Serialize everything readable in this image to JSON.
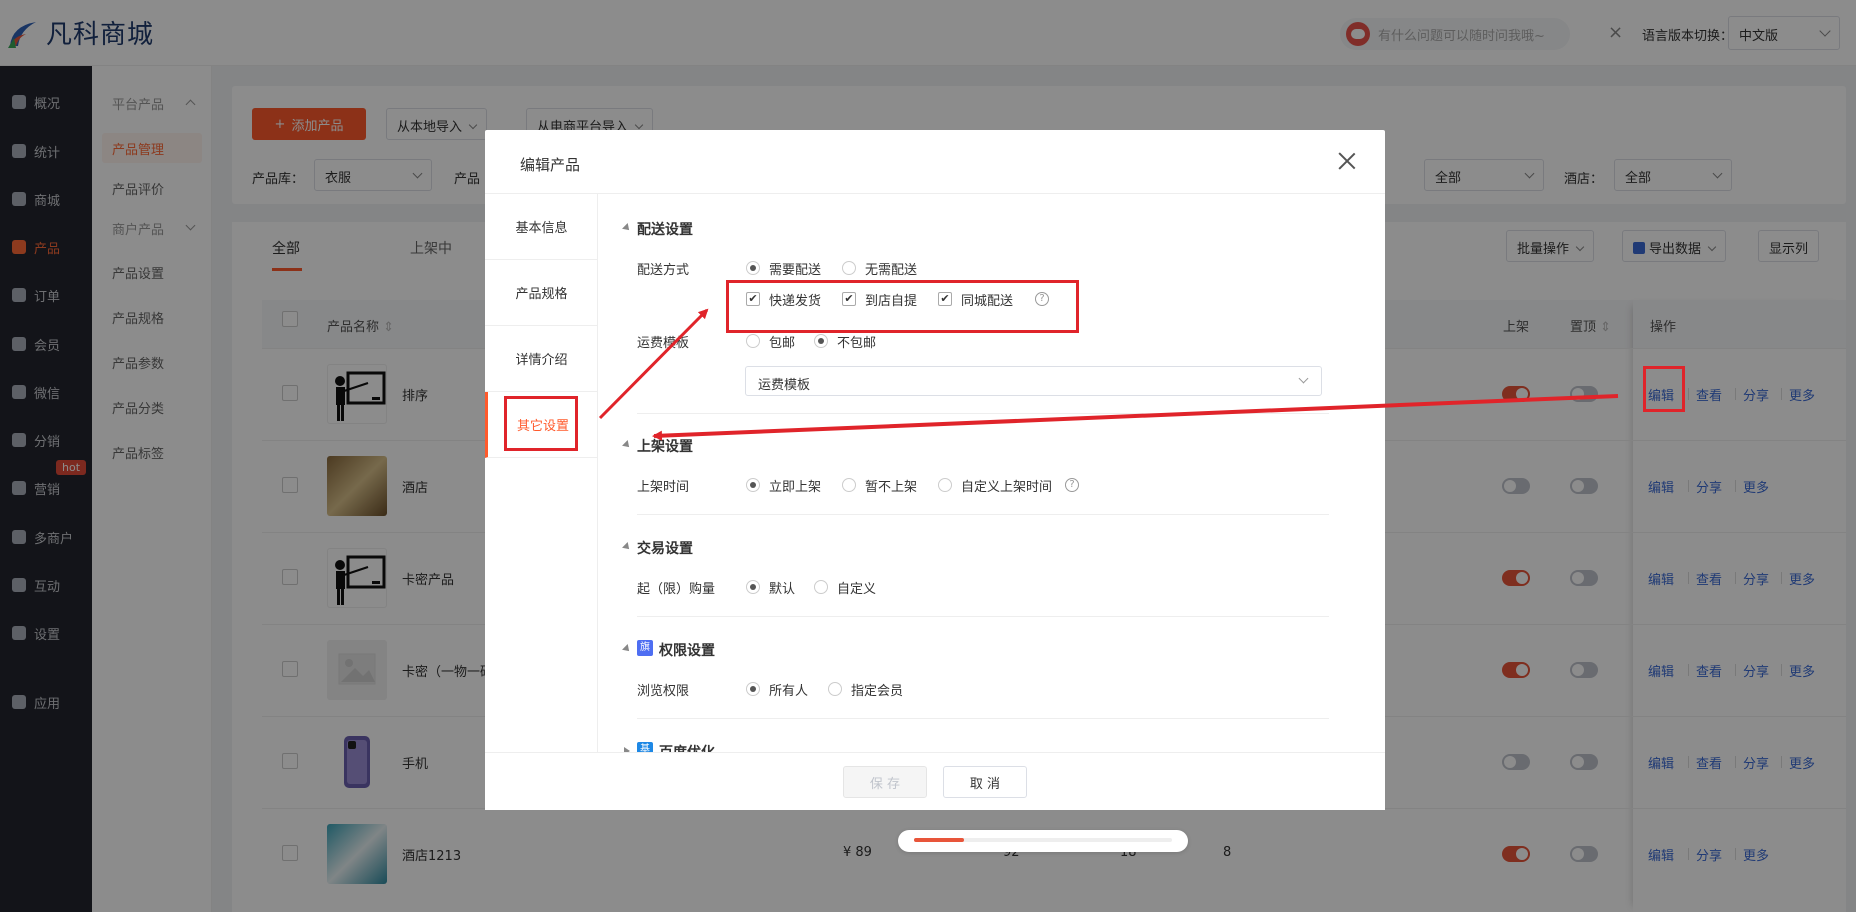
{
  "header": {
    "logo_text": "凡科商城",
    "ask_placeholder": "有什么问题可以随时问我哦~",
    "close_glyph": "×",
    "lang_label": "语言版本切换：",
    "lang_value": "中文版"
  },
  "nav": {
    "items": [
      "概况",
      "统计",
      "商城",
      "产品",
      "订单",
      "会员",
      "微信",
      "分销",
      "营销",
      "多商户",
      "互动",
      "设置",
      "应用"
    ],
    "hot_badge": "hot"
  },
  "subnav": {
    "group1": "平台产品",
    "items1": [
      "产品管理",
      "产品评价"
    ],
    "group2": "商户产品",
    "items2": [
      "产品设置",
      "产品规格",
      "产品参数",
      "产品分类",
      "产品标签"
    ]
  },
  "toolbar": {
    "add_btn": "添加产品",
    "add_plus": "+",
    "import_local": "从本地导入",
    "import_platform": "从电商平台导入"
  },
  "filters": {
    "lib_label": "产品库：",
    "lib_value": "衣服",
    "cut_label": "产品",
    "all_value": "全部",
    "hotel_label": "酒店：",
    "hotel_value": "全部"
  },
  "tabs": [
    "全部",
    "上架中"
  ],
  "table_actions": {
    "bulk": "批量操作",
    "export": "导出数据",
    "columns": "显示列"
  },
  "table": {
    "headers": {
      "name": "产品名称",
      "on": "上架",
      "top": "置顶",
      "ops": "操作"
    },
    "rows": [
      {
        "name": "排序",
        "on": true,
        "top": false,
        "ops": [
          "编辑",
          "查看",
          "分享",
          "更多"
        ]
      },
      {
        "name": "酒店",
        "on": false,
        "top": false,
        "ops": [
          "编辑",
          "分享",
          "更多"
        ]
      },
      {
        "name": "卡密产品",
        "on": true,
        "top": false,
        "ops": [
          "编辑",
          "查看",
          "分享",
          "更多"
        ]
      },
      {
        "name": "卡密（一物一码",
        "on": true,
        "top": false,
        "ops": [
          "编辑",
          "查看",
          "分享",
          "更多"
        ]
      },
      {
        "name": "手机",
        "on": false,
        "top": false,
        "ops": [
          "编辑",
          "查看",
          "分享",
          "更多"
        ]
      },
      {
        "name": "酒店1213",
        "price": "¥ 89",
        "c1": "92",
        "c2": "18",
        "c3": "8",
        "on": true,
        "top": false,
        "ops": [
          "编辑",
          "分享",
          "更多"
        ]
      }
    ]
  },
  "modal": {
    "title": "编辑产品",
    "side_tabs": [
      "基本信息",
      "产品规格",
      "详情介绍",
      "其它设置"
    ],
    "delivery": {
      "section": "配送设置",
      "method_label": "配送方式",
      "need": "需要配送",
      "no_need": "无需配送",
      "express": "快递发货",
      "pickup": "到店自提",
      "city": "同城配送",
      "check_glyph": "✔",
      "help_glyph": "?",
      "freight_label": "运费模板",
      "free": "包邮",
      "not_free": "不包邮",
      "template_value": "运费模板"
    },
    "listing": {
      "section": "上架设置",
      "time_label": "上架时间",
      "now": "立即上架",
      "later": "暂不上架",
      "custom": "自定义上架时间"
    },
    "trade": {
      "section": "交易设置",
      "qty_label": "起（限）购量",
      "default": "默认",
      "custom": "自定义"
    },
    "permission": {
      "badge": "旗",
      "section": "权限设置",
      "view_label": "浏览权限",
      "all": "所有人",
      "member": "指定会员"
    },
    "seo": {
      "badge": "基",
      "section": "百度优化"
    },
    "save": "保 存",
    "cancel": "取 消"
  },
  "colors": {
    "accent": "#ff5a2c",
    "annotation": "#e0242a",
    "link": "#3b6bd6"
  }
}
